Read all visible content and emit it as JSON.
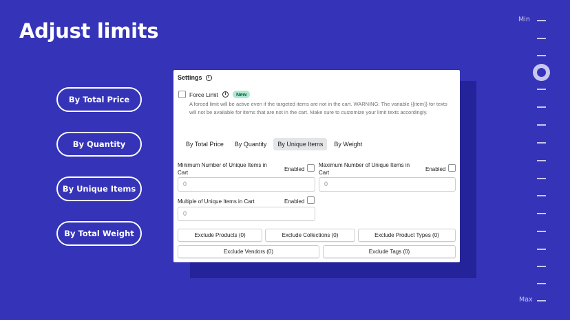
{
  "title": "Adjust limits",
  "pills": [
    "By Total Price",
    "By Quantity",
    "By Unique Items",
    "By Total Weight"
  ],
  "scale": {
    "min_label": "Min",
    "max_label": "Max"
  },
  "panel": {
    "heading": "Settings",
    "force_limit": {
      "label": "Force Limit",
      "badge": "New",
      "checked": false,
      "description": "A forced limit will be active even if the targeted items are not in the cart. WARNING: The variable {{item}} for texts will not be available for items that are not in the cart. Make sure to customize your limit texts accordingly."
    },
    "tabs": [
      "By Total Price",
      "By Quantity",
      "By Unique Items",
      "By Weight"
    ],
    "active_tab": "By Unique Items",
    "fields": {
      "min": {
        "label": "Minimum Number of Unique Items in Cart",
        "enabled_label": "Enabled",
        "placeholder": "0"
      },
      "max": {
        "label": "Maximum Number of Unique Items in Cart",
        "enabled_label": "Enabled",
        "placeholder": "0"
      },
      "multiple": {
        "label": "Multiple of Unique Items in Cart",
        "enabled_label": "Enabled",
        "placeholder": "0"
      }
    },
    "exclude_buttons": [
      "Exclude Products (0)",
      "Exclude Collections (0)",
      "Exclude Product Types (0)",
      "Exclude Vendors (0)",
      "Exclude Tags (0)"
    ]
  }
}
